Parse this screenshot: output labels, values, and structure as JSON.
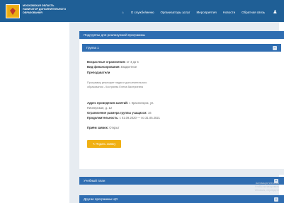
{
  "header": {
    "org_lines": [
      "МОСКОВСКАЯ ОБЛАСТЬ",
      "НАВИГАТОР ДОПОЛНИТЕЛЬНОГО",
      "ОБРАЗОВАНИЯ"
    ],
    "nav": [
      {
        "label": "О службе/меню",
        "name": "nav-about"
      },
      {
        "label": "Организаторы услуг",
        "name": "nav-providers"
      },
      {
        "label": "Мероприятия",
        "name": "nav-events"
      },
      {
        "label": "Новости",
        "name": "nav-news"
      },
      {
        "label": "Обратная связь",
        "name": "nav-feedback"
      }
    ],
    "user_label": "♟"
  },
  "panels": {
    "groups_title": "Подгруппы для реализуемой программы",
    "group_title": "Группа 1",
    "study_plan_title": "Учебный план",
    "other_programs_title": "Другие программы ЦО"
  },
  "group": {
    "age_label": "Возрастные ограничения:",
    "age_value": "от 4 до 5",
    "funding_label": "Вид финансирования:",
    "funding_value": "Бюджетное",
    "teachers_label": "Преподаватели",
    "description": [
      "Программу реализует педагог дополнительного",
      "образования - Костряева Елена Валериевна"
    ],
    "address_label": "Адрес проведения занятий:",
    "address_value": "г. Красногорск, ул.",
    "address_line2": "Пионерская, д. 12",
    "size_label": "Ограничение размера группы учащихся:",
    "size_value": "16",
    "duration_label": "Продолжительность:",
    "duration_value": "с 01.09.2020 — по 31.05.2021",
    "enroll_status_label": "Приём заявок:",
    "enroll_status_value": "Открыт",
    "enroll_button": "Подать заявку"
  },
  "watermark": [
    "Активация Windows",
    "Чтобы активировать",
    "Windows, перейдите"
  ],
  "colors": {
    "header": "#1f5f96",
    "panel": "#2f6db1",
    "accent_button": "#f0b013",
    "background": "#e7ecf1"
  }
}
